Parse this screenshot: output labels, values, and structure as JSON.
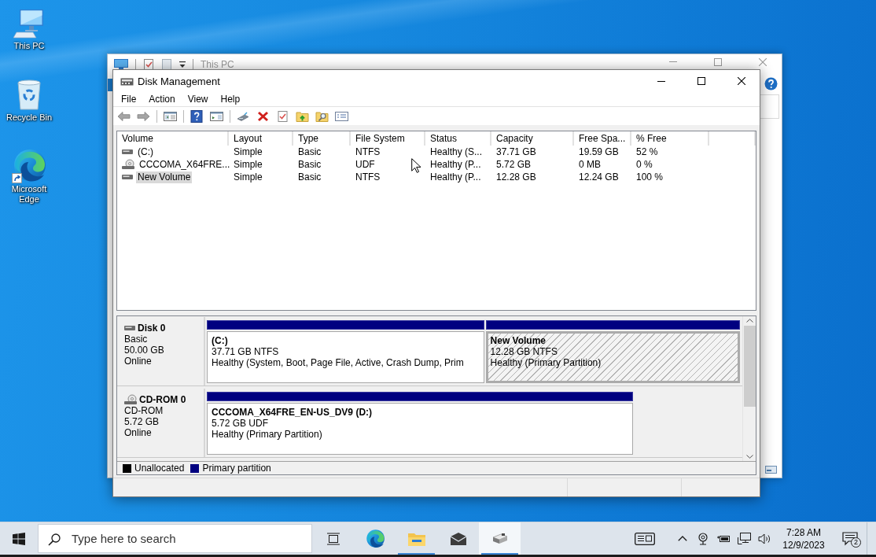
{
  "desktop_icons": [
    {
      "kind": "computer",
      "label": "This PC"
    },
    {
      "kind": "recycle-bin",
      "label": "Recycle Bin"
    },
    {
      "kind": "edge",
      "label": "Microsoft Edge"
    }
  ],
  "explorer_window": {
    "title": "This PC"
  },
  "disk_management": {
    "title": "Disk Management",
    "menu": [
      "File",
      "Action",
      "View",
      "Help"
    ],
    "volume_list": {
      "columns": [
        "Volume",
        "Layout",
        "Type",
        "File System",
        "Status",
        "Capacity",
        "Free Spa...",
        "% Free"
      ],
      "rows": [
        {
          "kind": "disk",
          "selected": false,
          "cells": [
            "(C:)",
            "Simple",
            "Basic",
            "NTFS",
            "Healthy (S...",
            "37.71 GB",
            "19.59 GB",
            "52 %"
          ]
        },
        {
          "kind": "cdrom",
          "selected": false,
          "cells": [
            "CCCOMA_X64FRE...",
            "Simple",
            "Basic",
            "UDF",
            "Healthy (P...",
            "5.72 GB",
            "0 MB",
            "0 %"
          ]
        },
        {
          "kind": "disk",
          "selected": true,
          "cells": [
            "New Volume",
            "Simple",
            "Basic",
            "NTFS",
            "Healthy (P...",
            "12.28 GB",
            "12.24 GB",
            "100 %"
          ]
        }
      ]
    },
    "disks": [
      {
        "kind": "disk",
        "name": "Disk 0",
        "type": "Basic",
        "size": "50.00 GB",
        "status": "Online",
        "partitions": [
          {
            "name": "(C:)",
            "size": "37.71 GB NTFS",
            "status": "Healthy (System, Boot, Page File, Active, Crash Dump, Prim",
            "selected": false
          },
          {
            "name": "New Volume",
            "size": "12.28 GB NTFS",
            "status": "Healthy (Primary Partition)",
            "selected": true
          }
        ]
      },
      {
        "kind": "cdrom",
        "name": "CD-ROM 0",
        "type": "CD-ROM",
        "size": "5.72 GB",
        "status": "Online",
        "partitions": [
          {
            "name": "CCCOMA_X64FRE_EN-US_DV9 (D:)",
            "size": "5.72 GB UDF",
            "status": "Healthy (Primary Partition)",
            "selected": false
          }
        ]
      }
    ],
    "legend": [
      {
        "label": "Unallocated",
        "color": "#000000"
      },
      {
        "label": "Primary partition",
        "color": "#000080"
      }
    ]
  },
  "taskbar": {
    "search": {
      "placeholder": "Type here to search"
    },
    "apps": [
      {
        "kind": "task-view",
        "running": false,
        "selected": false
      },
      {
        "kind": "edge",
        "running": false,
        "selected": false
      },
      {
        "kind": "file-explorer",
        "running": true,
        "selected": false
      },
      {
        "kind": "mail",
        "running": false,
        "selected": false
      },
      {
        "kind": "disk-management",
        "running": true,
        "selected": true
      }
    ],
    "clock": {
      "time": "7:28 AM",
      "date": "12/9/2023"
    },
    "notifications": "2"
  }
}
